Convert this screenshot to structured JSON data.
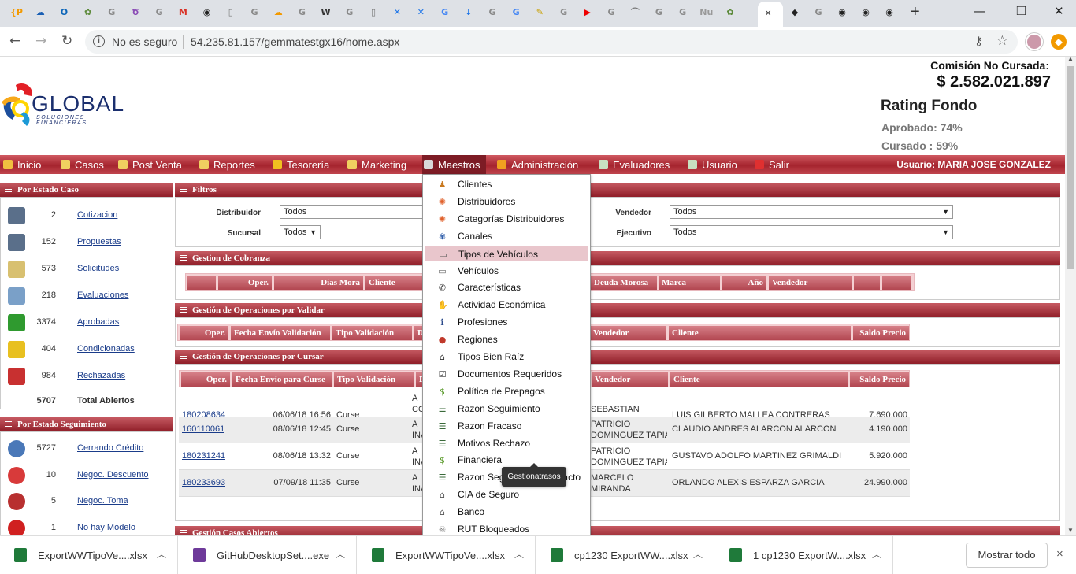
{
  "browser": {
    "active_tab_close": "×",
    "new_tab": "+",
    "insecure_label": "No es seguro",
    "url": "54.235.81.157/gemmatestgx16/home.aspx",
    "tab_icons": [
      {
        "glyph": "{P",
        "color": "#f29900",
        "name": "tab-p-icon"
      },
      {
        "glyph": "☁",
        "color": "#1a5fb4",
        "name": "tab-cloud-icon"
      },
      {
        "glyph": "O",
        "color": "#0a64b8",
        "name": "tab-outlook-icon"
      },
      {
        "glyph": "✿",
        "color": "#5c8a3a",
        "name": "tab-extension-icon"
      },
      {
        "glyph": "G",
        "color": "#8a8a8a",
        "name": "tab-google-icon"
      },
      {
        "glyph": "Ծ",
        "color": "#8a4bb5",
        "name": "tab-purple-icon"
      },
      {
        "glyph": "G",
        "color": "#8a8a8a",
        "name": "tab-google-icon"
      },
      {
        "glyph": "M",
        "color": "#d93025",
        "name": "tab-gmail-icon"
      },
      {
        "glyph": "◉",
        "color": "#222",
        "name": "tab-github-icon"
      },
      {
        "glyph": "▯",
        "color": "#777",
        "name": "tab-doc-icon"
      },
      {
        "glyph": "G",
        "color": "#8a8a8a",
        "name": "tab-google-icon"
      },
      {
        "glyph": "☁",
        "color": "#f29900",
        "name": "tab-orange-cloud-icon"
      },
      {
        "glyph": "G",
        "color": "#8a8a8a",
        "name": "tab-google-icon"
      },
      {
        "glyph": "W",
        "color": "#333",
        "name": "tab-wikipedia-icon"
      },
      {
        "glyph": "G",
        "color": "#8a8a8a",
        "name": "tab-google-icon"
      },
      {
        "glyph": "▯",
        "color": "#777",
        "name": "tab-doc-icon"
      },
      {
        "glyph": "✕",
        "color": "#1a73e8",
        "name": "tab-confluence-icon"
      },
      {
        "glyph": "✕",
        "color": "#1a73e8",
        "name": "tab-confluence-icon"
      },
      {
        "glyph": "G",
        "color": "#4285f4",
        "name": "tab-translate-icon"
      },
      {
        "glyph": "↓",
        "color": "#1a73e8",
        "name": "tab-download-icon"
      },
      {
        "glyph": "G",
        "color": "#8a8a8a",
        "name": "tab-google-icon"
      },
      {
        "glyph": "G",
        "color": "#4285f4",
        "name": "tab-translate-icon"
      },
      {
        "glyph": "✎",
        "color": "#c9a000",
        "name": "tab-note-icon"
      },
      {
        "glyph": "G",
        "color": "#8a8a8a",
        "name": "tab-google-icon"
      },
      {
        "glyph": "▶",
        "color": "#e00",
        "name": "tab-youtube-icon"
      },
      {
        "glyph": "G",
        "color": "#8a8a8a",
        "name": "tab-google-icon"
      },
      {
        "glyph": "⌒",
        "color": "#777",
        "name": "tab-wave-icon"
      },
      {
        "glyph": "G",
        "color": "#8a8a8a",
        "name": "tab-google-icon"
      },
      {
        "glyph": "G",
        "color": "#8a8a8a",
        "name": "tab-google-icon"
      },
      {
        "glyph": "Nu",
        "color": "#999",
        "name": "tab-nu-icon"
      },
      {
        "glyph": "✿",
        "color": "#5c8a3a",
        "name": "tab-extension-icon"
      }
    ],
    "tab_icons_after": [
      {
        "glyph": "◆",
        "color": "#222",
        "name": "tab-diamond-icon"
      },
      {
        "glyph": "G",
        "color": "#8a8a8a",
        "name": "tab-google-icon"
      },
      {
        "glyph": "◉",
        "color": "#222",
        "name": "tab-github-icon"
      },
      {
        "glyph": "◉",
        "color": "#222",
        "name": "tab-github-icon"
      },
      {
        "glyph": "◉",
        "color": "#222",
        "name": "tab-github-icon"
      }
    ]
  },
  "header": {
    "logo_word": "GLOBAL",
    "logo_sub": "SOLUCIONES FINANCIERAS",
    "commission_label": "Comisión No Cursada:",
    "commission_value": "$ 2.582.021.897",
    "rating_title": "Rating Fondo",
    "approved": "Aprobado: 74%",
    "cursado": "Cursado : 59%"
  },
  "menu": {
    "items": [
      {
        "label": "Inicio",
        "icon_color": "#f0c040"
      },
      {
        "label": "Casos",
        "icon_color": "#f0d060"
      },
      {
        "label": "Post Venta",
        "icon_color": "#f0d060"
      },
      {
        "label": "Reportes",
        "icon_color": "#f0d060"
      },
      {
        "label": "Tesorería",
        "icon_color": "#f0c020"
      },
      {
        "label": "Marketing",
        "icon_color": "#f0d060"
      },
      {
        "label": "Maestros",
        "icon_color": "#d8d8d8"
      },
      {
        "label": "Administración",
        "icon_color": "#f0a020"
      },
      {
        "label": "Evaluadores",
        "icon_color": "#c8e0c0"
      },
      {
        "label": "Usuario",
        "icon_color": "#c8e0c0"
      },
      {
        "label": "Salir",
        "icon_color": "#e03030"
      }
    ],
    "user_label": "Usuario:  MARIA JOSE GONZALEZ"
  },
  "left_estado": {
    "title": "Por Estado Caso",
    "rows": [
      {
        "num": "2",
        "label": "Cotizacion",
        "icon": "calculator-icon",
        "color": "#5a6f8a"
      },
      {
        "num": "152",
        "label": "Propuestas",
        "icon": "calculator-icon",
        "color": "#5a6f8a"
      },
      {
        "num": "573",
        "label": "Solicitudes",
        "icon": "document-pen-icon",
        "color": "#d8c070"
      },
      {
        "num": "218",
        "label": "Evaluaciones",
        "icon": "magnifier-icon",
        "color": "#7aa0c8"
      },
      {
        "num": "3374",
        "label": "Aprobadas",
        "icon": "shield-check-icon",
        "color": "#2f9a2f"
      },
      {
        "num": "404",
        "label": "Condicionadas",
        "icon": "shield-warning-icon",
        "color": "#e8c020"
      },
      {
        "num": "984",
        "label": "Rechazadas",
        "icon": "shield-x-icon",
        "color": "#c83030"
      }
    ],
    "total_num": "5707",
    "total_label": "Total Abiertos"
  },
  "left_seguimiento": {
    "title": "Por Estado Seguimiento",
    "rows": [
      {
        "num": "5727",
        "label": "Cerrando Crédito",
        "icon": "signature-icon",
        "color": "#4a78b8"
      },
      {
        "num": "10",
        "label": "Negoc. Descuento",
        "icon": "percent-tag-icon",
        "color": "#d83a3a"
      },
      {
        "num": "5",
        "label": "Negoc. Toma",
        "icon": "gauge-icon",
        "color": "#b83030"
      },
      {
        "num": "1",
        "label": "No hay Modelo",
        "icon": "x-circle-icon",
        "color": "#d02020"
      }
    ]
  },
  "filters": {
    "title": "Filtros",
    "distribuidor_label": "Distribuidor",
    "distribuidor_value": "Todos",
    "sucursal_label": "Sucursal",
    "sucursal_value": "Todos",
    "vendedor_label": "Vendedor",
    "vendedor_value": "Todos",
    "ejecutivo_label": "Ejecutivo",
    "ejecutivo_value": "Todos"
  },
  "cobranza": {
    "title": "Gestion de Cobranza",
    "headers": [
      "",
      "Oper.",
      "Dias Mora",
      "Cliente",
      "Deuda Morosa",
      "Marca",
      "Año",
      "Vendedor",
      "",
      ""
    ]
  },
  "validar": {
    "title": "Gestión de Operaciones por Validar",
    "headers": [
      "Oper.",
      "Fecha Envío Validación",
      "Tipo Validación",
      "D",
      "Vendedor",
      "Cliente",
      "Saldo Precio"
    ]
  },
  "cursar": {
    "title": "Gestión de Operaciones por Cursar",
    "headers": [
      "Oper.",
      "Fecha Envío para Curse",
      "Tipo Validación",
      "D",
      "Vendedor",
      "Cliente",
      "Saldo Precio"
    ],
    "rows": [
      {
        "oper": "180208634",
        "fecha": "06/06/18 16:56",
        "tipo": "Curse",
        "d": "A\nCO\nCO\nEC",
        "vend": "SEBASTIAN\nPIZARRO",
        "cliente": "LUIS GILBERTO MALLEA CONTRERAS",
        "saldo": "7.690.000"
      },
      {
        "oper": "160110061",
        "fecha": "08/06/18 12:45",
        "tipo": "Curse",
        "d": "A\nINA",
        "vend": "PATRICIO\nDOMINGUEZ TAPIA",
        "cliente": "CLAUDIO ANDRES ALARCON ALARCON",
        "saldo": "4.190.000"
      },
      {
        "oper": "180231241",
        "fecha": "08/06/18 13:32",
        "tipo": "Curse",
        "d": "A\nINA",
        "vend": "PATRICIO\nDOMINGUEZ TAPIA",
        "cliente": "GUSTAVO ADOLFO MARTINEZ GRIMALDI",
        "saldo": "5.920.000"
      },
      {
        "oper": "180233693",
        "fecha": "07/09/18 11:35",
        "tipo": "Curse",
        "d": "A\nINA",
        "vend": "MARCELO\nMIRANDA",
        "cliente": "ORLANDO ALEXIS ESPARZA GARCIA",
        "saldo": "24.990.000"
      }
    ]
  },
  "abiertos": {
    "title": "Gestión Casos Abiertos"
  },
  "dropdown": {
    "items": [
      {
        "label": "Clientes",
        "icon": "person-icon",
        "glyph": "♟",
        "color": "#c8781e"
      },
      {
        "label": "Distribuidores",
        "icon": "ubuntu-icon",
        "glyph": "✺",
        "color": "#e0602a"
      },
      {
        "label": "Categorías Distribuidores",
        "icon": "ubuntu-icon",
        "glyph": "✺",
        "color": "#e0602a"
      },
      {
        "label": "Canales",
        "icon": "network-icon",
        "glyph": "✾",
        "color": "#2a5aa8"
      },
      {
        "label": "Tipos de Vehículos",
        "icon": "vehicle-add-icon",
        "glyph": "▭",
        "color": "#555"
      },
      {
        "label": "Vehículos",
        "icon": "vehicle-icon",
        "glyph": "▭",
        "color": "#666"
      },
      {
        "label": "Características",
        "icon": "phone-icon",
        "glyph": "✆",
        "color": "#333"
      },
      {
        "label": "Actividad Económica",
        "icon": "handshake-icon",
        "glyph": "✋",
        "color": "#6aa02a"
      },
      {
        "label": "Profesiones",
        "icon": "info-icon",
        "glyph": "ℹ",
        "color": "#2a4a8a"
      },
      {
        "label": "Regiones",
        "icon": "map-pin-icon",
        "glyph": "●",
        "color": "#c0392b"
      },
      {
        "label": "Tipos Bien Raíz",
        "icon": "house-icon",
        "glyph": "⌂",
        "color": "#333"
      },
      {
        "label": "Documentos Requeridos",
        "icon": "checkbox-icon",
        "glyph": "☑",
        "color": "#333"
      },
      {
        "label": "Política de Prepagos",
        "icon": "money-icon",
        "glyph": "$",
        "color": "#5a9a2a"
      },
      {
        "label": "Razon Seguimiento",
        "icon": "list-icon",
        "glyph": "☰",
        "color": "#3a6a3a"
      },
      {
        "label": "Razon Fracaso",
        "icon": "list-icon",
        "glyph": "☰",
        "color": "#3a6a3a"
      },
      {
        "label": "Motivos Rechazo",
        "icon": "list-icon",
        "glyph": "☰",
        "color": "#3a6a3a"
      },
      {
        "label": "Financiera",
        "icon": "money-icon",
        "glyph": "$",
        "color": "#5a9a2a"
      },
      {
        "label": "Razon Seguimiento Contacto",
        "icon": "list-icon",
        "glyph": "☰",
        "color": "#3a6a3a"
      },
      {
        "label": "CIA de Seguro",
        "icon": "bank-icon",
        "glyph": "⌂",
        "color": "#555"
      },
      {
        "label": "Banco",
        "icon": "bank-icon",
        "glyph": "⌂",
        "color": "#555"
      },
      {
        "label": "RUT Bloqueados",
        "icon": "skull-icon",
        "glyph": "☠",
        "color": "#777"
      }
    ],
    "highlighted_index": 4,
    "tooltip": "Gestionatrasos"
  },
  "downloads": {
    "items": [
      {
        "name": "ExportWWTipoVe....xlsx",
        "color": "#1f7a3a"
      },
      {
        "name": "GitHubDesktopSet....exe",
        "color": "#6e3a9a"
      },
      {
        "name": "ExportWWTipoVe....xlsx",
        "color": "#1f7a3a"
      },
      {
        "name": "cp1230 ExportWW....xlsx",
        "color": "#1f7a3a"
      },
      {
        "name": "1 cp1230 ExportW....xlsx",
        "color": "#1f7a3a"
      }
    ],
    "show_all": "Mostrar todo",
    "close": "×"
  }
}
